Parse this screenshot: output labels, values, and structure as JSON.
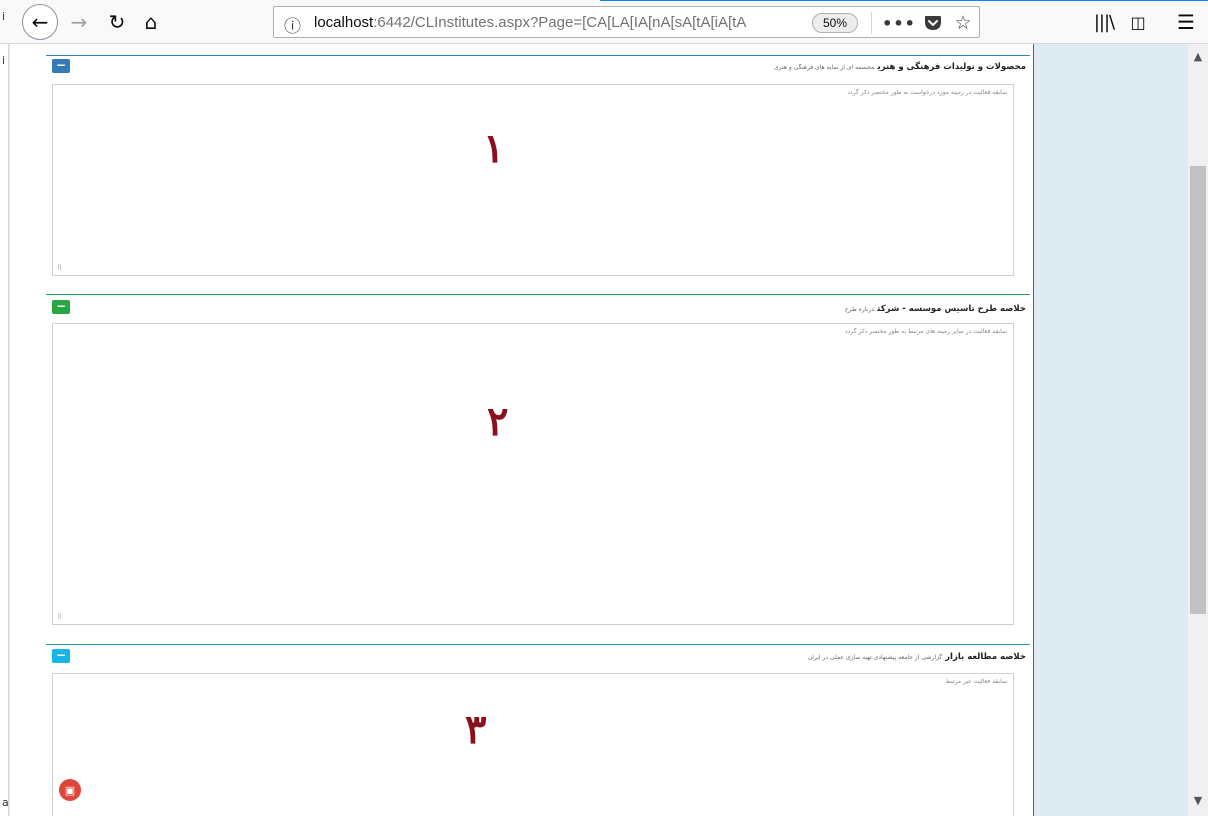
{
  "browser": {
    "back_icon": "arrow-left-icon",
    "forward_icon": "arrow-right-icon",
    "url_host": "localhost",
    "url_rest": ":6442/CLInstitutes.aspx?Page=[CA[LA[IA[nA[sA[tA[iA[tA",
    "zoom": "50%",
    "more": "•••",
    "edge_labels": [
      "i",
      "i",
      "a"
    ]
  },
  "panels": [
    {
      "title": "محصولات و تولیدات فرهنگی و هنری",
      "subtitle": "مجسمه ای از نمایه های فرهنگی و هنری",
      "hint": "سابقه فعالیت در زمینه مورد درخواست به طور مختصر ذکر گردد",
      "number": "١",
      "accent": "#337ab7"
    },
    {
      "title": "خلاصه طرح تاسیس موسسه - شرکت",
      "subtitle": "درباره طرح",
      "hint": "سابقه فعالیت در سایر زمینه های مرتبط به طور مختصر ذکر گردد",
      "number": "٢",
      "accent": "#28a745"
    },
    {
      "title": "خلاصه مطالعه بازار",
      "subtitle": "گزارشی از جامعه پیشنهادی تهیه سازی عملی در ایران",
      "hint": "سابقه فعالیت غیر مرتبط",
      "number": "٣",
      "accent": "#17b4e6"
    }
  ]
}
